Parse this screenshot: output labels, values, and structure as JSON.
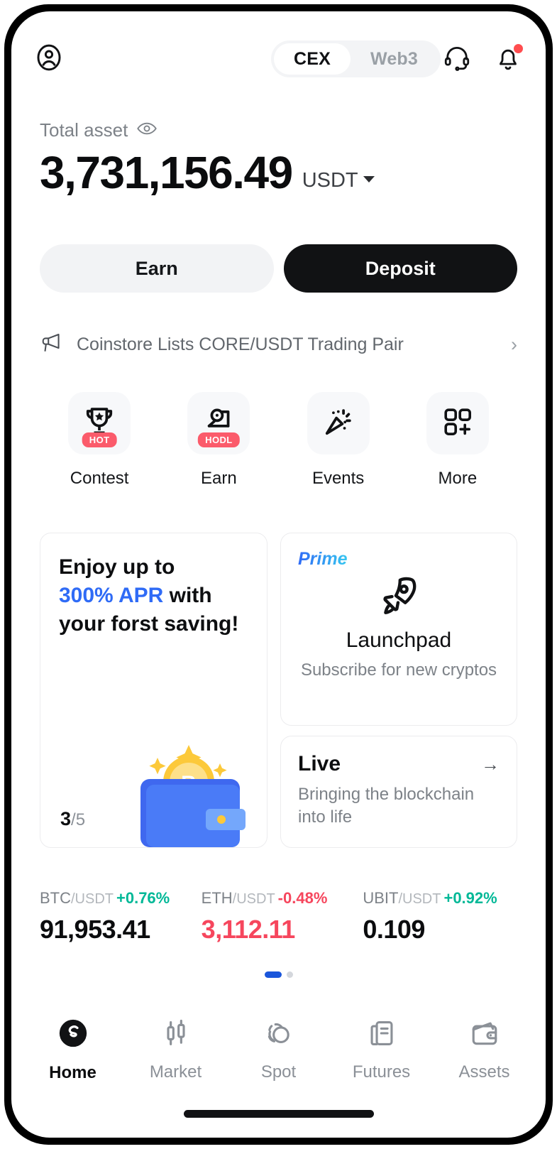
{
  "topbar": {
    "avatar_icon": "user-circle-icon",
    "segments": [
      {
        "label": "CEX",
        "active": true
      },
      {
        "label": "Web3",
        "active": false
      }
    ],
    "support_icon": "headset-icon",
    "notifications_icon": "bell-icon",
    "has_notification_badge": true
  },
  "balance": {
    "label": "Total asset",
    "eye_icon": "eye-icon",
    "amount": "3,731,156.49",
    "currency": "USDT"
  },
  "actions": {
    "earn_label": "Earn",
    "deposit_label": "Deposit"
  },
  "announcement": {
    "icon": "megaphone-icon",
    "text": "Coinstore Lists CORE/USDT Trading Pair",
    "chevron": "›"
  },
  "quick_actions": [
    {
      "label": "Contest",
      "icon": "trophy-icon",
      "badge": "HOT"
    },
    {
      "label": "Earn",
      "icon": "hodl-coin-icon",
      "badge": "HODL"
    },
    {
      "label": "Events",
      "icon": "confetti-icon",
      "badge": ""
    },
    {
      "label": "More",
      "icon": "grid-plus-icon",
      "badge": ""
    }
  ],
  "promo_card": {
    "line1": "Enjoy up to",
    "accent": "300% APR",
    "line2_tail": " with",
    "line3": "your forst saving!",
    "counter_current": "3",
    "counter_total": "/5",
    "art_icon": "wallet-bitcoin-icon"
  },
  "launchpad_card": {
    "tag": "Prime",
    "icon": "rocket-icon",
    "title": "Launchpad",
    "subtitle": "Subscribe for new cryptos"
  },
  "live_card": {
    "title": "Live",
    "arrow": "→",
    "subtitle": "Bringing the blockchain into life"
  },
  "tickers": [
    {
      "base": "BTC",
      "quote": "/USDT",
      "change": "+0.76%",
      "direction": "up",
      "price": "91,953.41",
      "price_color": "black"
    },
    {
      "base": "ETH",
      "quote": "/USDT",
      "change": "-0.48%",
      "direction": "down",
      "price": "3,112.11",
      "price_color": "red"
    },
    {
      "base": "UBIT",
      "quote": "/USDT",
      "change": "+0.92%",
      "direction": "up",
      "price": "0.109",
      "price_color": "black"
    }
  ],
  "pager": {
    "pages": 2,
    "active_index": 0
  },
  "tabbar": [
    {
      "label": "Home",
      "icon": "logo-s-icon",
      "active": true
    },
    {
      "label": "Market",
      "icon": "candlestick-icon",
      "active": false
    },
    {
      "label": "Spot",
      "icon": "spot-circles-icon",
      "active": false
    },
    {
      "label": "Futures",
      "icon": "document-icon",
      "active": false
    },
    {
      "label": "Assets",
      "icon": "wallet-icon",
      "active": false
    }
  ],
  "colors": {
    "up": "#00b897",
    "down": "#f6465d",
    "accent_blue": "#2f6bf6",
    "badge_red": "#fb5b6b",
    "primary_dark": "#111214"
  }
}
